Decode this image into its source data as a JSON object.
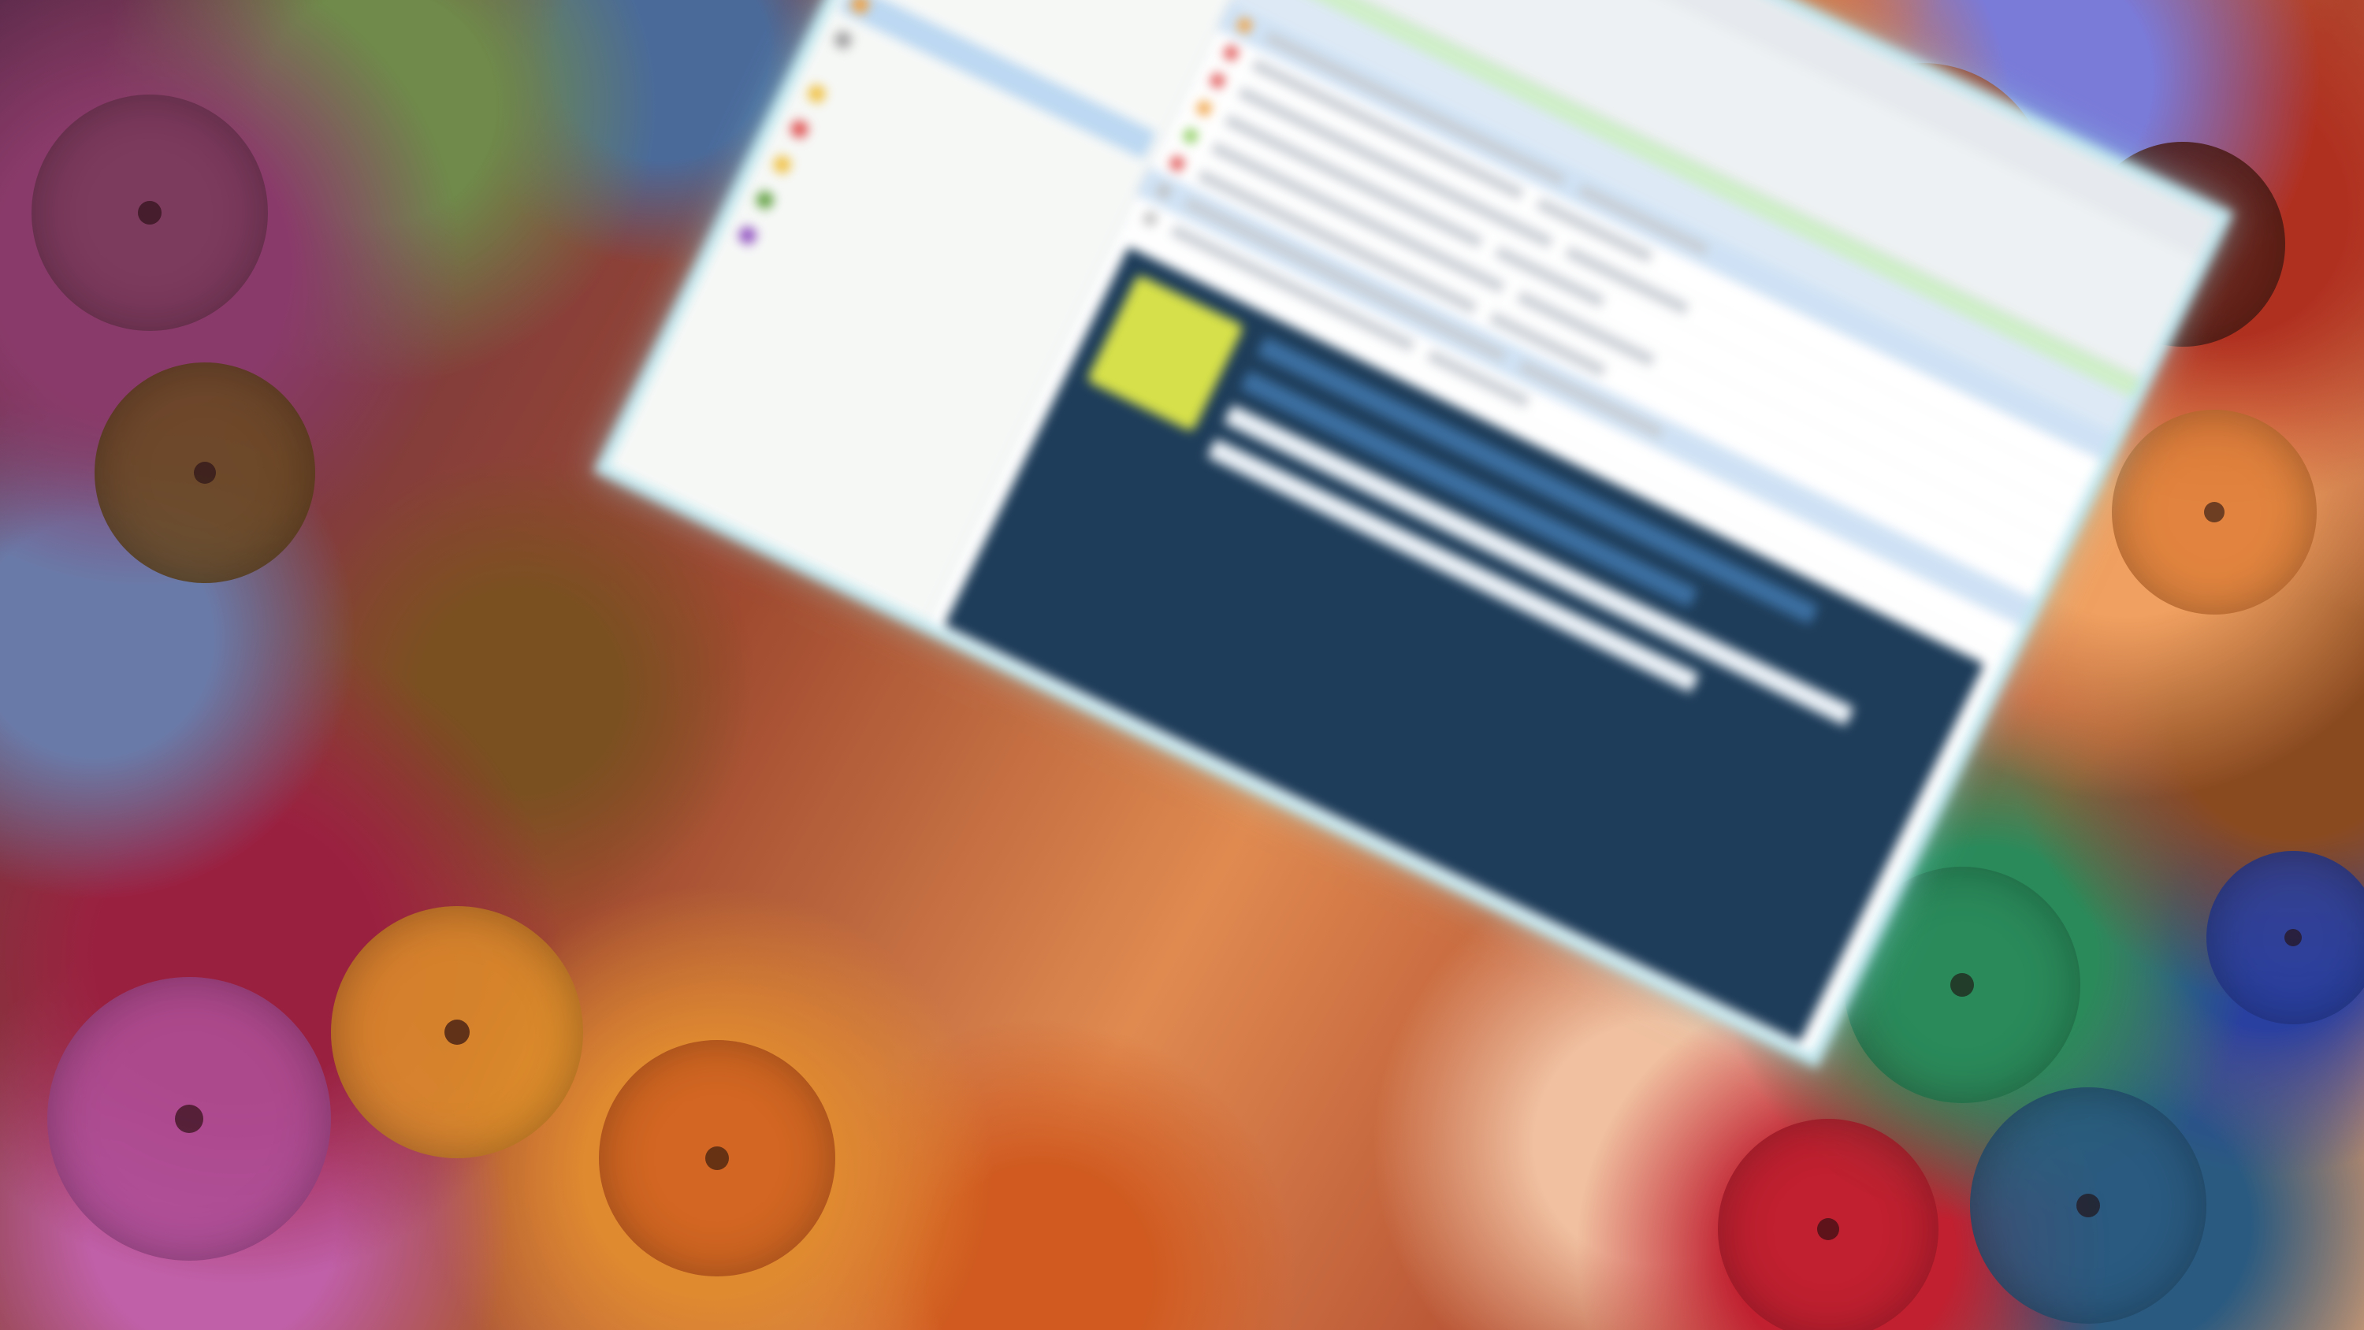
{
  "background": {
    "description_colors": [
      "#8a3a6a",
      "#e07030",
      "#2a8a5a",
      "#2a40a0",
      "#c02030",
      "#d6a040"
    ]
  },
  "window": {
    "accent_color": "#bfe6ee",
    "titlebar": {
      "items": [
        "",
        "",
        ""
      ]
    },
    "ribbon": {
      "buttons": [
        {
          "label": "",
          "icon": "calendar-icon",
          "color": "#f0a040"
        },
        {
          "label": "",
          "icon": "new-item-icon",
          "color": "#f0a040"
        },
        {
          "label": "",
          "icon": "reply-icon",
          "color": "#8acb5a"
        },
        {
          "label": "",
          "icon": "forward-icon",
          "color": "#8acb5a"
        },
        {
          "label": "",
          "icon": "categorize-icon",
          "color": "#e05050"
        },
        {
          "label": "",
          "icon": "share-icon",
          "color": "#5080d0"
        }
      ]
    },
    "nav": {
      "groups": [
        {
          "label": "",
          "items": [
            {
              "label": "",
              "color": "#f0a040",
              "selected": false
            },
            {
              "label": "",
              "color": "#f0c040",
              "selected": false
            },
            {
              "label": "",
              "color": "#f0c040",
              "selected": false
            },
            {
              "label": "",
              "color": "#60a040",
              "selected": false
            },
            {
              "label": "",
              "color": "#f0a040",
              "selected": true
            },
            {
              "label": "",
              "color": "#a0a0a0",
              "selected": false
            }
          ]
        },
        {
          "label": "",
          "items": [
            {
              "label": "",
              "color": "#f0c040",
              "selected": false
            },
            {
              "label": "",
              "color": "#e05050",
              "selected": false
            },
            {
              "label": "",
              "color": "#f0c040",
              "selected": false
            },
            {
              "label": "",
              "color": "#60a040",
              "selected": false
            },
            {
              "label": "",
              "color": "#9050c0",
              "selected": false
            }
          ]
        }
      ]
    },
    "table": {
      "headers": [
        "",
        "",
        "",
        ""
      ],
      "rows": [
        {
          "flag": "#f0a040",
          "selected": true
        },
        {
          "flag": "#e05050",
          "selected": false
        },
        {
          "flag": "#e05050",
          "selected": false
        },
        {
          "flag": "#f0a040",
          "selected": false
        },
        {
          "flag": "#8acb5a",
          "selected": false
        },
        {
          "flag": "#e05050",
          "selected": false
        },
        {
          "flag": "#c0c0c0",
          "selected": true
        },
        {
          "flag": "#c0c0c0",
          "selected": false
        }
      ]
    },
    "preview": {
      "logo_color": "#d6e04a",
      "panel_color": "#1e3d5a"
    }
  }
}
